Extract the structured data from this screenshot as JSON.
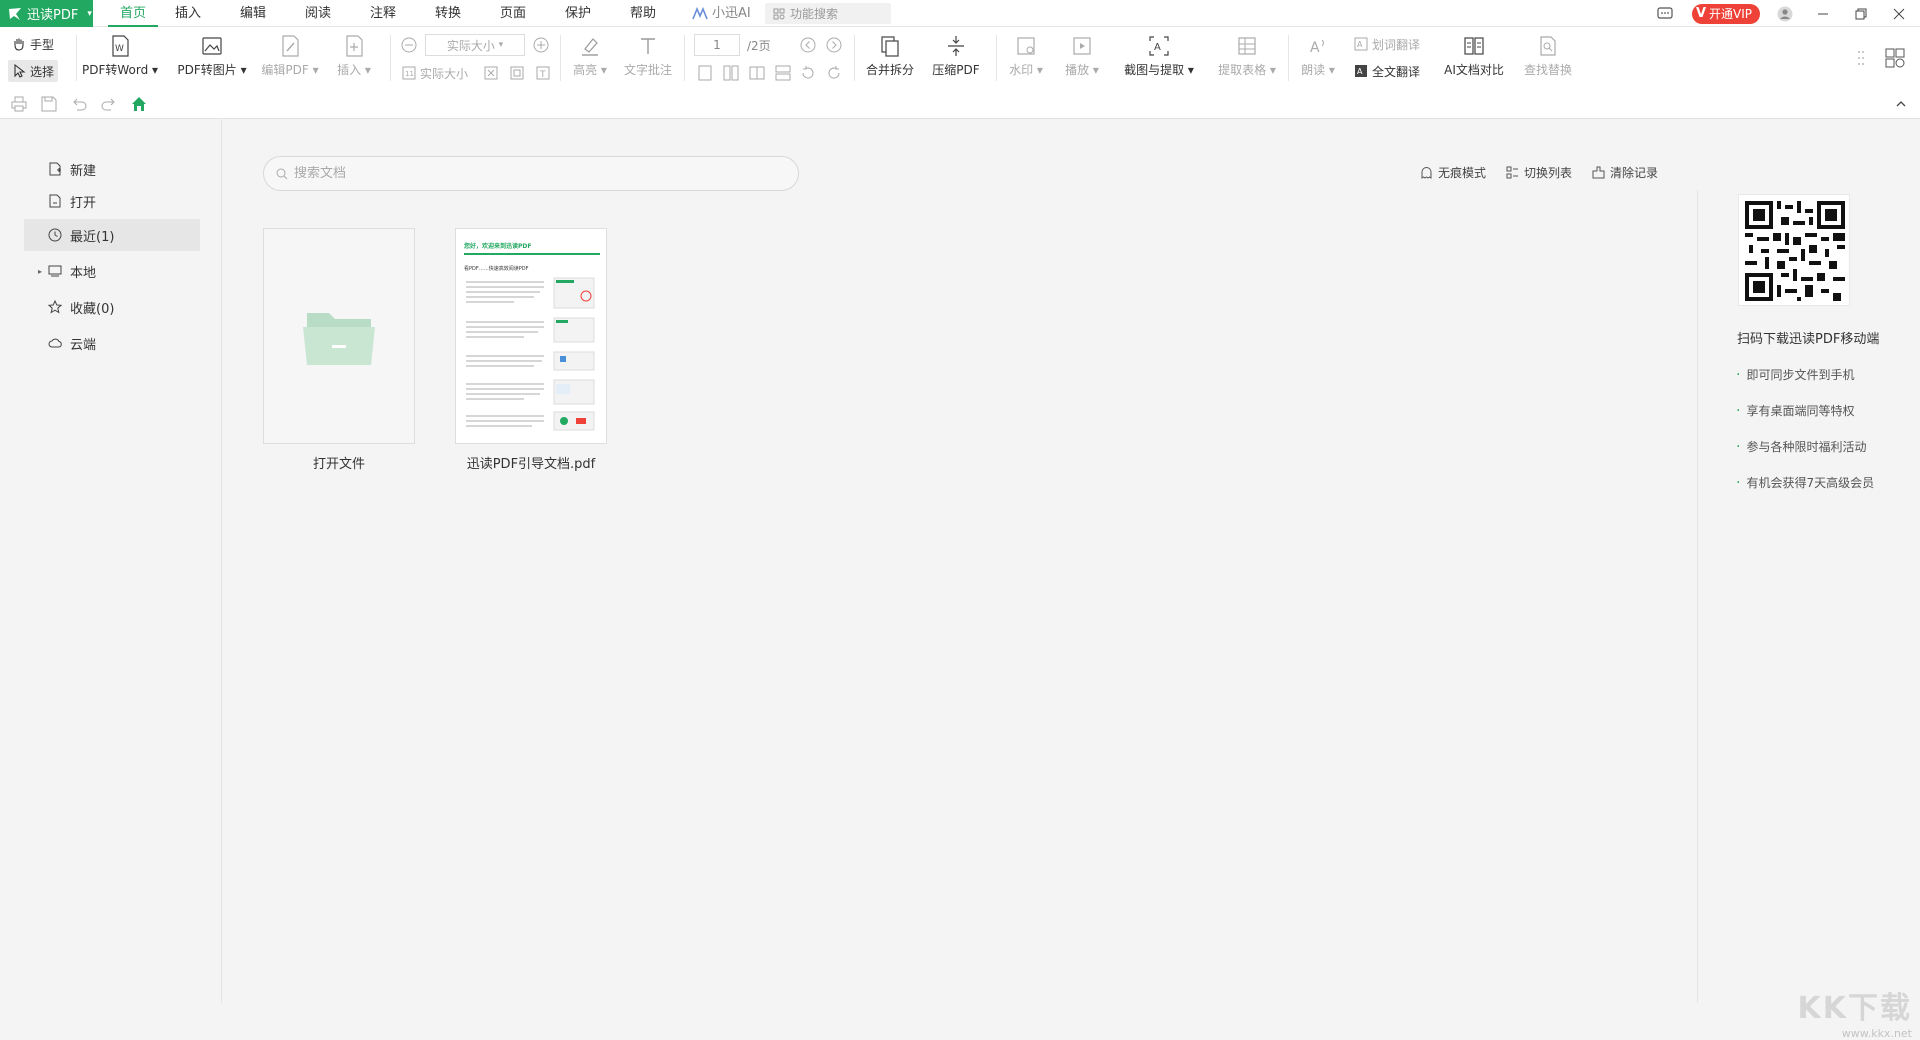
{
  "titlebar": {
    "app_name": "迅读PDF",
    "menu_tabs": [
      "首页",
      "插入",
      "编辑",
      "阅读",
      "注释",
      "转换",
      "页面",
      "保护",
      "帮助"
    ],
    "ai_tab": "小迅AI",
    "function_search_placeholder": "功能搜索",
    "vip_label": "开通VIP"
  },
  "ribbon": {
    "hand_tool": "手型",
    "select_tool": "选择",
    "pdf_to_word": "PDF转Word",
    "pdf_to_image": "PDF转图片",
    "edit_pdf": "编辑PDF",
    "insert": "插入",
    "zoom_value": "实际大小",
    "actual_size": "实际大小",
    "highlight": "高亮",
    "text_annot": "文字批注",
    "page_number": "1",
    "page_total": "/2页",
    "merge_split": "合并拆分",
    "compress": "压缩PDF",
    "watermark": "水印",
    "play": "播放",
    "screenshot_extract": "截图与提取",
    "extract_table": "提取表格",
    "read_aloud": "朗读",
    "word_translate": "划词翻译",
    "full_translate": "全文翻译",
    "ai_compare": "AI文档对比",
    "find_replace": "查找替换"
  },
  "nav": {
    "items": [
      {
        "label": "新建",
        "icon": "new-file-icon"
      },
      {
        "label": "打开",
        "icon": "open-file-icon"
      },
      {
        "label": "最近(1)",
        "icon": "clock-icon"
      },
      {
        "label": "本地",
        "icon": "computer-icon"
      },
      {
        "label": "收藏(0)",
        "icon": "star-icon"
      },
      {
        "label": "云端",
        "icon": "cloud-icon"
      }
    ]
  },
  "main": {
    "search_placeholder": "搜索文档",
    "incognito": "无痕模式",
    "switch_list": "切换列表",
    "clear_history": "清除记录",
    "files": [
      {
        "label": "打开文件"
      },
      {
        "label": "迅读PDF引导文档.pdf",
        "thumb_title": "您好，欢迎来到迅读PDF",
        "thumb_heading": "看PDF……快速高效阅读PDF"
      }
    ]
  },
  "promo": {
    "title": "扫码下载迅读PDF移动端",
    "perks": [
      "即可同步文件到手机",
      "享有桌面端同等特权",
      "参与各种限时福利活动",
      "有机会获得7天高级会员"
    ]
  },
  "watermark": {
    "big": "KK下载",
    "url": "www.kkx.net"
  },
  "colors": {
    "accent": "#22a860",
    "vip": "#ee4238"
  }
}
